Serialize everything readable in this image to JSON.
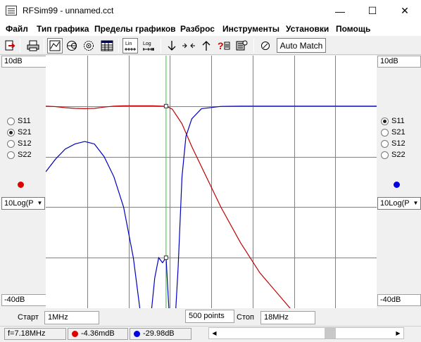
{
  "window": {
    "title": "RFSim99 - unnamed.cct",
    "minimize": "—",
    "maximize": "☐",
    "close": "✕"
  },
  "menu": [
    "Файл",
    "Тип графика",
    "Пределы графиков",
    "Разброс",
    "Инструменты",
    "Установки",
    "Помощь"
  ],
  "toolbar": {
    "auto_match": "Auto Match",
    "lin_label": "Lin",
    "log_label": "Log",
    "icons": [
      "exit-icon",
      "print-icon",
      "rect-plot-icon",
      "smith-chart-icon",
      "polar-chart-icon",
      "table-icon",
      "lin-scale-icon",
      "log-scale-icon",
      "arrow-down-icon",
      "zoom-in-icon",
      "arrow-up-icon",
      "help-icon",
      "tuning-icon",
      "tune-knob-icon"
    ]
  },
  "left_panel": {
    "top_label": "10dB",
    "bottom_label": "-40dB",
    "params": [
      "S11",
      "S21",
      "S12",
      "S22"
    ],
    "selected": "S21",
    "marker_color": "#e00000",
    "scale_select": "10Log(P"
  },
  "right_panel": {
    "top_label": "10dB",
    "bottom_label": "-40dB",
    "params": [
      "S11",
      "S21",
      "S12",
      "S22"
    ],
    "selected": "S11",
    "marker_color": "#0000e0",
    "scale_select": "10Log(P"
  },
  "bottom": {
    "start_label": "Старт",
    "start_value": "1MHz",
    "points": "500 points",
    "stop_label": "Стоп",
    "stop_value": "18MHz"
  },
  "status": {
    "freq": "f=7.18MHz",
    "red_value": "-4.36mdB",
    "blue_value": "-29.98dB"
  },
  "chart_data": {
    "type": "line",
    "x_range_mhz": [
      1,
      18
    ],
    "y_range_db": [
      -40,
      10
    ],
    "grid": true,
    "cursor_x_mhz": 7.18,
    "series": [
      {
        "color": "#c00000",
        "x": [
          1,
          1.5,
          2,
          2.5,
          3,
          3.5,
          4,
          4.5,
          5,
          5.5,
          6,
          6.5,
          7,
          7.18,
          7.5,
          8,
          8.5,
          9,
          10,
          11,
          12,
          14,
          16,
          18
        ],
        "y": [
          0.0,
          -0.1,
          -0.3,
          -0.45,
          -0.5,
          -0.45,
          -0.2,
          0.0,
          0.05,
          0.05,
          0.05,
          0.05,
          0.0,
          0.0,
          -0.6,
          -3.5,
          -8,
          -12,
          -20,
          -27,
          -33,
          -42,
          -50,
          -56
        ]
      },
      {
        "color": "#0000c0",
        "x": [
          1,
          1.5,
          2,
          2.5,
          3,
          3.5,
          4,
          4.5,
          5,
          5.5,
          6,
          6.3,
          6.6,
          6.8,
          7.0,
          7.18,
          7.4,
          7.6,
          7.8,
          8.0,
          8.2,
          8.5,
          9,
          10,
          11,
          14,
          18
        ],
        "y": [
          -13,
          -10.5,
          -8.5,
          -7.5,
          -7,
          -7.5,
          -10,
          -14,
          -20,
          -30,
          -45,
          -60,
          -34,
          -30,
          -31,
          -30,
          -45,
          -60,
          -32,
          -14,
          -6,
          -2.5,
          -0.5,
          -0.05,
          0.0,
          0.0,
          0.0
        ]
      }
    ]
  }
}
